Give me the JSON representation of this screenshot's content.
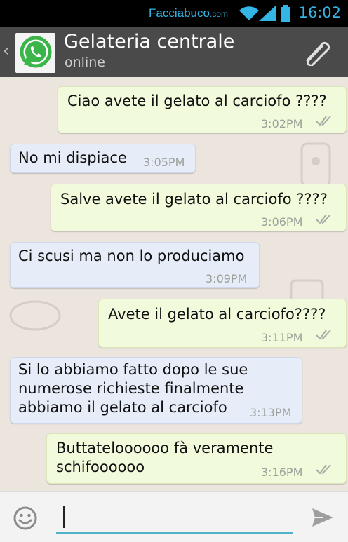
{
  "status_bar": {
    "brand_name": "Facciabuco",
    "brand_tld": ".com",
    "time": "16:02"
  },
  "header": {
    "contact_name": "Gelateria centrale",
    "status": "online"
  },
  "messages": [
    {
      "direction": "outgoing",
      "text": "Ciao avete il gelato al carciofo ????",
      "time": "3:02PM"
    },
    {
      "direction": "incoming",
      "text": "No mi dispiace",
      "time": "3:05PM"
    },
    {
      "direction": "outgoing",
      "text": "Salve avete il gelato al carciofo ????",
      "time": "3:06PM"
    },
    {
      "direction": "incoming",
      "text": "Ci scusi ma non lo produciamo",
      "time": "3:09PM"
    },
    {
      "direction": "outgoing",
      "text": "Avete il gelato al carciofo????",
      "time": "3:11PM"
    },
    {
      "direction": "incoming",
      "lines": [
        "Si lo abbiamo fatto dopo le sue",
        "numerose richieste finalmente",
        "abbiamo il gelato al carciofo"
      ],
      "time": "3:13PM"
    },
    {
      "direction": "outgoing",
      "lines": [
        "Buttateloooooo fà veramente",
        "schifoooooo"
      ],
      "time": "3:16PM"
    }
  ],
  "input": {
    "value": "",
    "icons": [
      "smiley-icon",
      "send-icon"
    ]
  },
  "colors": {
    "header_bg": "#4a4a4a",
    "chat_bg": "#ece5dd",
    "outgoing_bubble": "#f2fadc",
    "incoming_bubble": "#e6ecf8",
    "accent": "#33b5e5"
  }
}
